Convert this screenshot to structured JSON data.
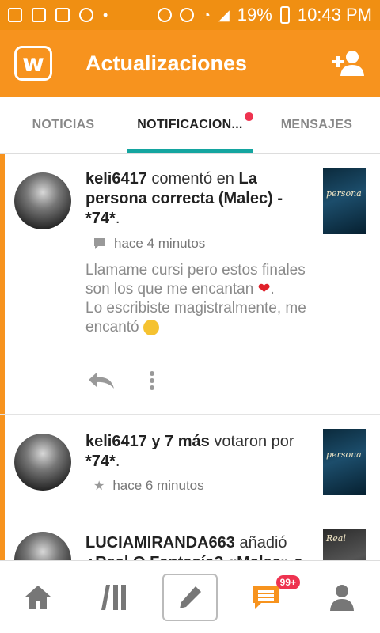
{
  "status_bar": {
    "battery": "19%",
    "time": "10:43 PM"
  },
  "app_bar": {
    "logo_letter": "w",
    "title": "Actualizaciones"
  },
  "tabs": [
    {
      "label": "NOTICIAS"
    },
    {
      "label": "NOTIFICACION..."
    },
    {
      "label": "MENSAJES"
    }
  ],
  "notifications": [
    {
      "user": "keli6417",
      "action": " comentó en ",
      "target": "La persona correcta (Malec) - *74*",
      "suffix": ".",
      "time": "hace 4 minutos",
      "body_line1": "Llamame cursi pero estos finales son los que me encantan",
      "body_line2": "Lo escribiste magistralmente, me encantó",
      "cover_text": "persona"
    },
    {
      "user": "keli6417 y 7 más",
      "action": " votaron por ",
      "target": "*74*",
      "suffix": ".",
      "time": "hace 6 minutos",
      "cover_text": "persona"
    },
    {
      "user": "LUCIAMIRANDA663",
      "action": " añadió",
      "target": "¿Real O Fantasía? «Malec» a",
      "cover_text": "Real"
    }
  ],
  "bottom_nav": {
    "badge": "99+"
  },
  "colors": {
    "primary": "#f7931e",
    "tab_indicator": "#14a5a0",
    "badge": "#ee3350"
  }
}
